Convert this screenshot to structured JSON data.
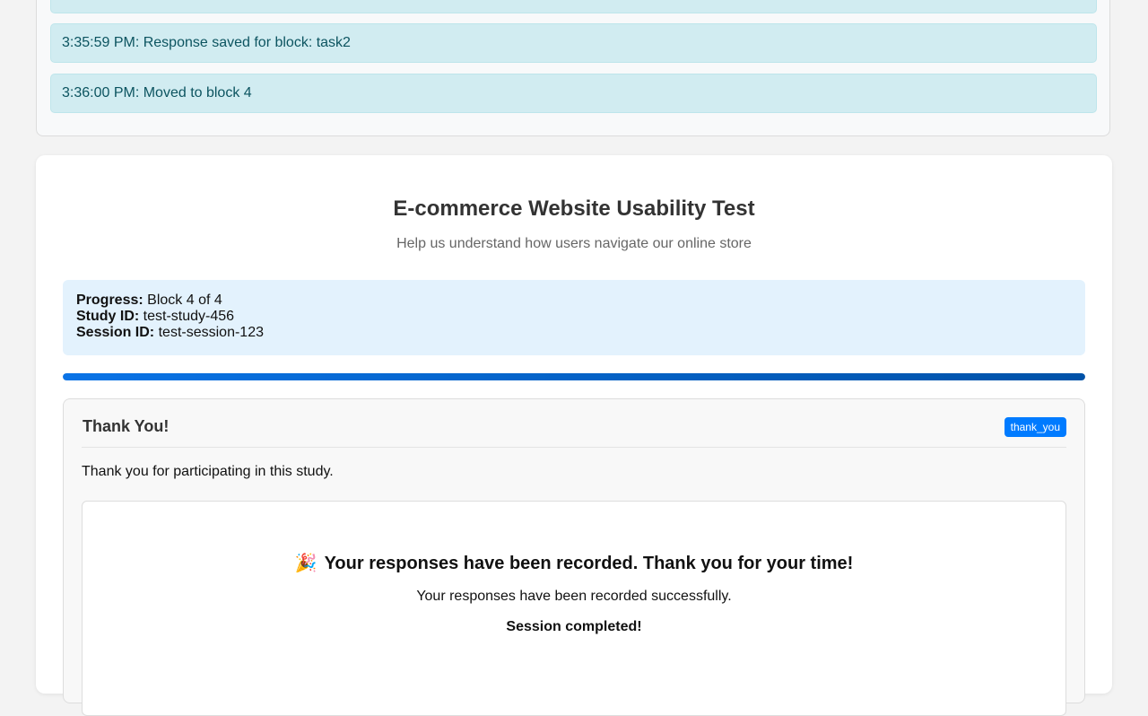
{
  "log": {
    "entries": [
      "",
      "3:35:59 PM: Response saved for block: task2",
      "3:36:00 PM: Moved to block 4"
    ]
  },
  "study": {
    "title": "E-commerce Website Usability Test",
    "subtitle": "Help us understand how users navigate our online store",
    "progress_label": "Progress:",
    "progress_value": "Block 4 of 4",
    "progress_fraction": 1.0,
    "study_id_label": "Study ID:",
    "study_id": "test-study-456",
    "session_id_label": "Session ID:",
    "session_id": "test-session-123",
    "accent_color": "#007bff",
    "log_color": "#d1ecf1"
  },
  "block": {
    "title": "Thank You!",
    "badge": "thank_you",
    "description": "Thank you for participating in this study.",
    "heading_icon": "party-popper-icon",
    "heading_emoji": "🎉",
    "heading": "Your responses have been recorded. Thank you for your time!",
    "message": "Your responses have been recorded successfully.",
    "status": "Session completed!"
  }
}
